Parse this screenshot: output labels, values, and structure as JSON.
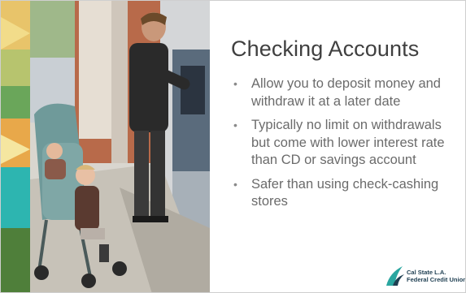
{
  "slide": {
    "title": "Checking Accounts",
    "bullets": [
      "Allow you to deposit money and withdraw it at a later date",
      "Typically no limit on withdrawals but come with lower interest rate than CD or savings account",
      "Safer than using check-cashing stores"
    ],
    "bullet_glyph": "•",
    "logo": {
      "line1": "Cal State L.A.",
      "line2": "Federal Credit Union"
    },
    "colors": {
      "title": "#404040",
      "body": "#6b6b6b",
      "logo_teal": "#2aa6a0",
      "logo_navy": "#1f3f52"
    }
  }
}
